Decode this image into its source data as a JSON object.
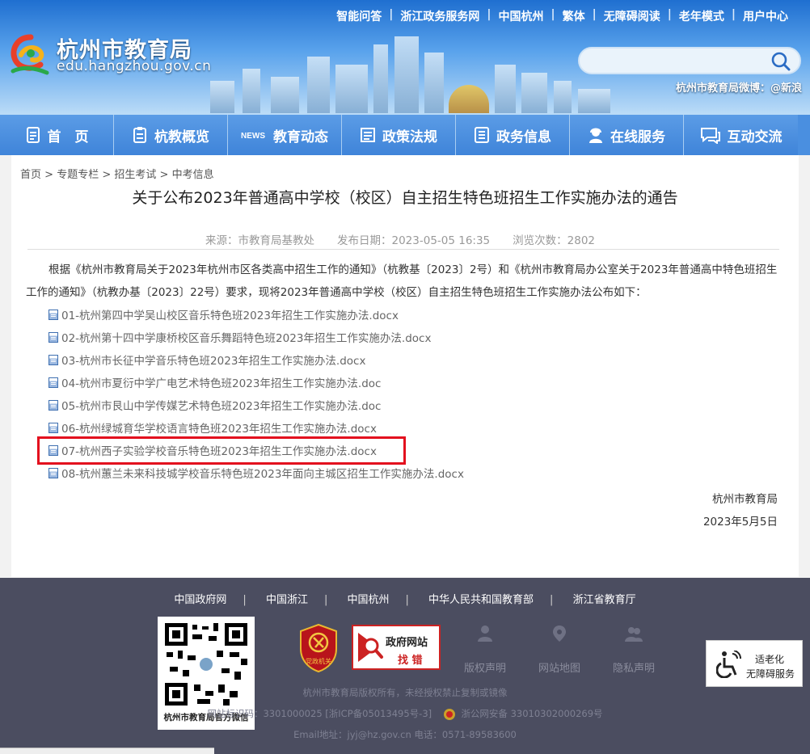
{
  "header": {
    "top_links": [
      "智能问答",
      "浙江政务服务网",
      "中国杭州",
      "繁体",
      "无障碍阅读",
      "老年模式",
      "用户中心"
    ],
    "site_title": "杭州市教育局",
    "site_url": "edu.hangzhou.gov.cn",
    "search_placeholder": "",
    "weibo": "杭州市教育局微博：@新浪"
  },
  "nav": [
    {
      "label": "首　页",
      "icon": "home-doc-icon"
    },
    {
      "label": "杭教概览",
      "icon": "overview-icon"
    },
    {
      "label": "教育动态",
      "icon": "news-icon"
    },
    {
      "label": "政策法规",
      "icon": "policy-icon"
    },
    {
      "label": "政务信息",
      "icon": "info-icon"
    },
    {
      "label": "在线服务",
      "icon": "service-icon"
    },
    {
      "label": "互动交流",
      "icon": "chat-icon"
    }
  ],
  "breadcrumb": [
    "首页",
    "专题专栏",
    "招生考试",
    "中考信息"
  ],
  "article": {
    "title": "关于公布2023年普通高中学校（校区）自主招生特色班招生工作实施办法的通告",
    "source": "来源：市教育局基教处",
    "date": "发布日期：2023-05-05 16:35",
    "views": "浏览次数：2802",
    "intro": "根据《杭州市教育局关于2023年杭州市区各类高中招生工作的通知》（杭教基〔2023〕2号）和《杭州市教育局办公室关于2023年普通高中特色班招生工作的通知》（杭教办基〔2023〕22号）要求，现将2023年普通高中学校（校区）自主招生特色班招生工作实施办法公布如下：",
    "attachments": [
      "01-杭州第四中学吴山校区音乐特色班2023年招生工作实施办法.docx",
      "02-杭州第十四中学康桥校区音乐舞蹈特色班2023年招生工作实施办法.docx",
      "03-杭州市长征中学音乐特色班2023年招生工作实施办法.docx",
      "04-杭州市夏衍中学广电艺术特色班2023年招生工作实施办法.doc",
      "05-杭州市艮山中学传媒艺术特色班2023年招生工作实施办法.doc",
      "06-杭州绿城育华学校语言特色班2023年招生工作实施办法.docx",
      "07-杭州西子实验学校音乐特色班2023年招生工作实施办法.docx",
      "08-杭州蕙兰未来科技城学校音乐特色班2023年面向主城区招生工作实施办法.docx"
    ],
    "signature": "杭州市教育局",
    "sign_date": "2023年5月5日"
  },
  "footer": {
    "links": [
      "中国政府网",
      "中国浙江",
      "中国杭州",
      "中华人民共和国教育部",
      "浙江省教育厅"
    ],
    "qr_caption": "杭州市教育局官方微信",
    "gov_badge_line1": "政府网站",
    "gov_badge_line2": "找 错",
    "party_label": "党政机关",
    "icons": [
      "版权声明",
      "网站地图",
      "隐私声明"
    ],
    "copyright": "杭州市教育局版权所有，未经授权禁止复制或镜像",
    "icp": "网站标识码：3301000025  [浙ICP备05013495号-3]",
    "police": "浙公网安备 33010302000269号",
    "contact": "Email地址：jyj@hz.gov.cn 电话：0571-89583600",
    "elder_line1": "适老化",
    "elder_line2": "无障碍服务"
  },
  "colors": {
    "nav_blue": "#4a8fe0",
    "highlight_red": "#e3101e",
    "footer_bg": "#4b4d60"
  }
}
